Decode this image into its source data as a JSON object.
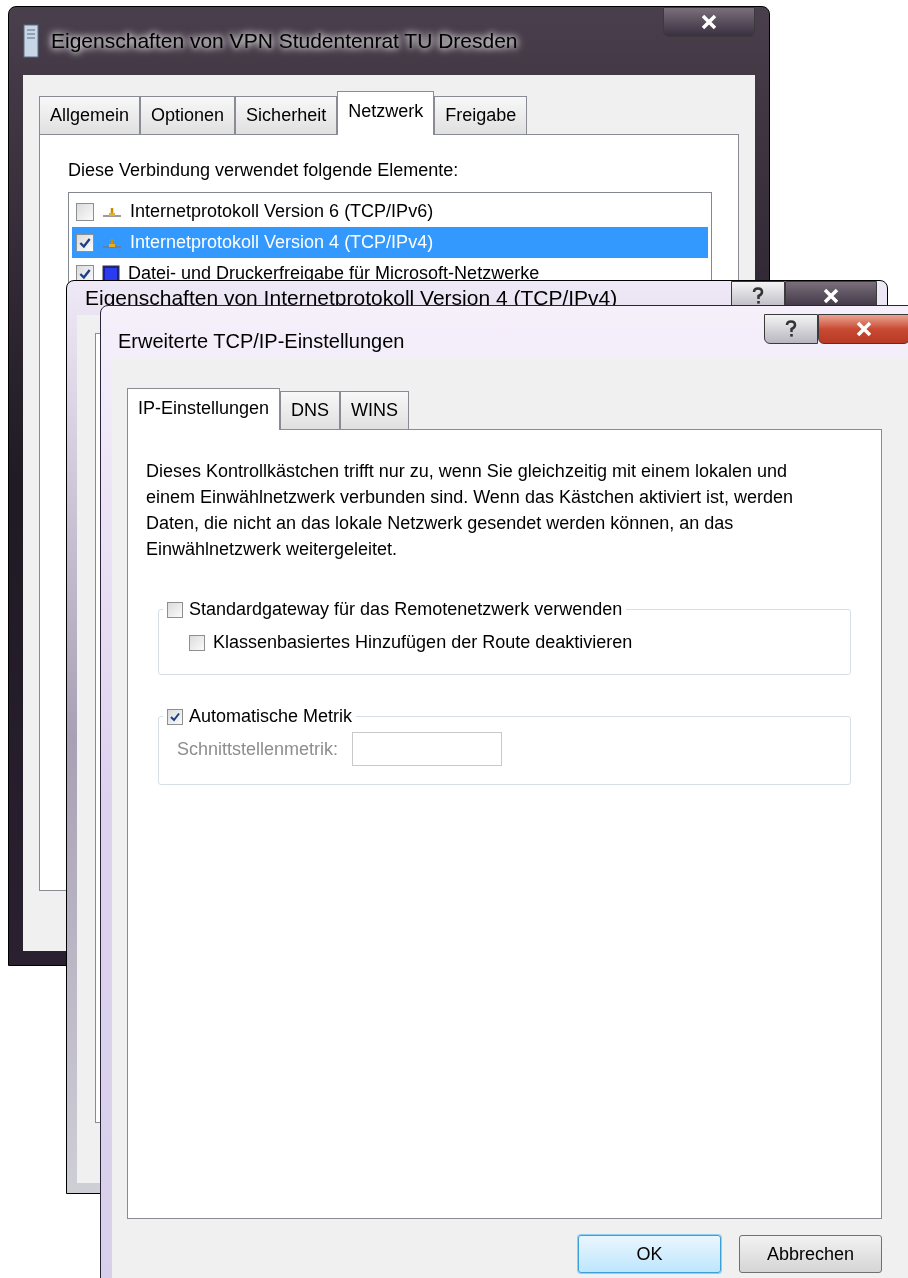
{
  "connection_window": {
    "title": "Eigenschaften von VPN Studentenrat TU Dresden",
    "active": false,
    "tabs": [
      {
        "label": "Allgemein",
        "selected": false
      },
      {
        "label": "Optionen",
        "selected": false
      },
      {
        "label": "Sicherheit",
        "selected": false
      },
      {
        "label": "Netzwerk",
        "selected": true
      },
      {
        "label": "Freigabe",
        "selected": false
      }
    ],
    "list_label": "Diese Verbindung verwendet folgende Elemente:",
    "items": [
      {
        "kind": "protocol",
        "label": "Internetprotokoll Version 6 (TCP/IPv6)",
        "checked": false,
        "selected": false
      },
      {
        "kind": "protocol",
        "label": "Internetprotokoll Version 4 (TCP/IPv4)",
        "checked": true,
        "selected": true
      },
      {
        "kind": "service",
        "label": "Datei- und Druckerfreigabe für Microsoft-Netzwerke",
        "checked": true,
        "selected": false
      }
    ]
  },
  "ipv4_window": {
    "title": "Eigenschaften von Internetprotokoll Version 4 (TCP/IPv4)",
    "active": false
  },
  "advanced_window": {
    "title": "Erweiterte TCP/IP-Einstellungen",
    "active": true,
    "tabs": [
      {
        "label": "IP-Einstellungen",
        "selected": true
      },
      {
        "label": "DNS",
        "selected": false
      },
      {
        "label": "WINS",
        "selected": false
      }
    ],
    "description": "Dieses Kontrollkästchen trifft nur zu, wenn Sie gleichzeitig mit einem lokalen und einem Einwählnetzwerk verbunden sind. Wenn das Kästchen aktiviert ist, werden Daten, die nicht an das lokale Netzwerk gesendet werden können, an das Einwählnetzwerk weitergeleitet.",
    "groups": [
      {
        "label": "Standardgateway für das Remotenetzwerk verwenden",
        "checked": false,
        "option": {
          "kind": "checkbox",
          "label": "Klassenbasiertes Hinzufügen der Route deaktivieren",
          "checked": false,
          "disabled": false
        }
      },
      {
        "label": "Automatische Metrik",
        "checked": true,
        "option": {
          "kind": "field",
          "label": "Schnittstellenmetrik:",
          "disabled": true
        }
      }
    ],
    "buttons": [
      {
        "label": "OK",
        "default": true
      },
      {
        "label": "Abbrechen",
        "default": false
      }
    ]
  }
}
